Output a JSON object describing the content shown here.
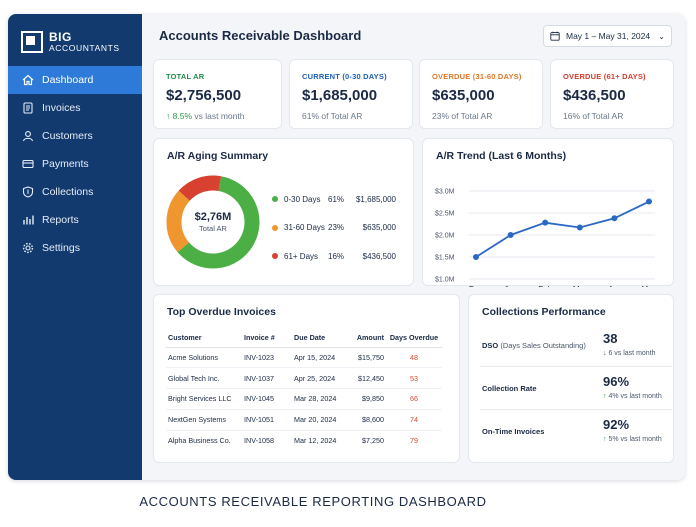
{
  "brand": {
    "name": "BIG",
    "sub": "ACCOUNTANTS"
  },
  "sidebar": {
    "items": [
      {
        "label": "Dashboard",
        "icon": "home-icon",
        "active": true
      },
      {
        "label": "Invoices",
        "icon": "invoice-icon"
      },
      {
        "label": "Customers",
        "icon": "user-icon"
      },
      {
        "label": "Payments",
        "icon": "card-icon"
      },
      {
        "label": "Collections",
        "icon": "shield-icon"
      },
      {
        "label": "Reports",
        "icon": "chart-icon"
      },
      {
        "label": "Settings",
        "icon": "gear-icon"
      }
    ]
  },
  "header": {
    "title": "Accounts Receivable Dashboard",
    "date_range": "May 1 – May 31, 2024"
  },
  "kpis": [
    {
      "label": "TOTAL AR",
      "value": "$2,756,500",
      "arrow": "↑",
      "change": "8.5%",
      "sub": "vs last month",
      "color": "#1f8a4a"
    },
    {
      "label": "CURRENT (0-30 DAYS)",
      "value": "$1,685,000",
      "sub": "61% of Total AR",
      "color": "#1c5fb8"
    },
    {
      "label": "OVERDUE (31-60 DAYS)",
      "value": "$635,000",
      "sub": "23% of Total AR",
      "color": "#e0782a"
    },
    {
      "label": "OVERDUE (61+ DAYS)",
      "value": "$436,500",
      "sub": "16% of Total AR",
      "color": "#d23c2c"
    }
  ],
  "aging": {
    "title": "A/R Aging Summary",
    "center_value": "$2,76M",
    "center_label": "Total AR",
    "segments": [
      {
        "name": "0-30 Days",
        "pct": "61%",
        "amount": "$1,685,000",
        "value": 61,
        "color": "#4caf46"
      },
      {
        "name": "31-60 Days",
        "pct": "23%",
        "amount": "$635,000",
        "value": 23,
        "color": "#f0962e"
      },
      {
        "name": "61+ Days",
        "pct": "16%",
        "amount": "$436,500",
        "value": 16,
        "color": "#d8412f"
      }
    ]
  },
  "chart_data": {
    "type": "line",
    "title": "A/R Trend (Last 6 Months)",
    "categories": [
      "Dec",
      "Jan",
      "Feb",
      "Mar",
      "Apr",
      "May"
    ],
    "values": [
      1.5,
      2.0,
      2.28,
      2.17,
      2.38,
      2.76
    ],
    "ylim": [
      1.0,
      3.0
    ],
    "yticks": [
      1.0,
      1.5,
      2.0,
      2.5,
      3.0
    ],
    "ytick_labels": [
      "$1.0M",
      "$1.5M",
      "$2.0M",
      "$2.5M",
      "$3.0M"
    ],
    "color": "#2a68c4",
    "grid": true
  },
  "overdue": {
    "title": "Top Overdue Invoices",
    "columns": [
      "Customer",
      "Invoice #",
      "Due Date",
      "Amount",
      "Days Overdue"
    ],
    "rows": [
      [
        "Acme Solutions",
        "INV-1023",
        "Apr 15, 2024",
        "$15,750",
        "48"
      ],
      [
        "Global Tech Inc.",
        "INV-1037",
        "Apr 25, 2024",
        "$12,450",
        "53"
      ],
      [
        "Bright Services LLC",
        "INV-1045",
        "Mar 28, 2024",
        "$9,850",
        "66"
      ],
      [
        "NextGen Systems",
        "INV-1051",
        "Mar 20, 2024",
        "$8,600",
        "74"
      ],
      [
        "Alpha Business Co.",
        "INV-1058",
        "Mar 12, 2024",
        "$7,250",
        "79"
      ]
    ]
  },
  "collections": {
    "title": "Collections Performance",
    "items": [
      {
        "name": "DSO",
        "name_sub": "(Days Sales Outstanding)",
        "value": "38",
        "arrow": "↓",
        "sub": "6 vs last month"
      },
      {
        "name": "Collection Rate",
        "name_sub": "",
        "value": "96%",
        "arrow": "↑",
        "sub": "4% vs last month"
      },
      {
        "name": "On-Time Invoices",
        "name_sub": "",
        "value": "92%",
        "arrow": "↑",
        "sub": "5% vs last month"
      }
    ]
  },
  "caption": "ACCOUNTS RECEIVABLE REPORTING DASHBOARD"
}
